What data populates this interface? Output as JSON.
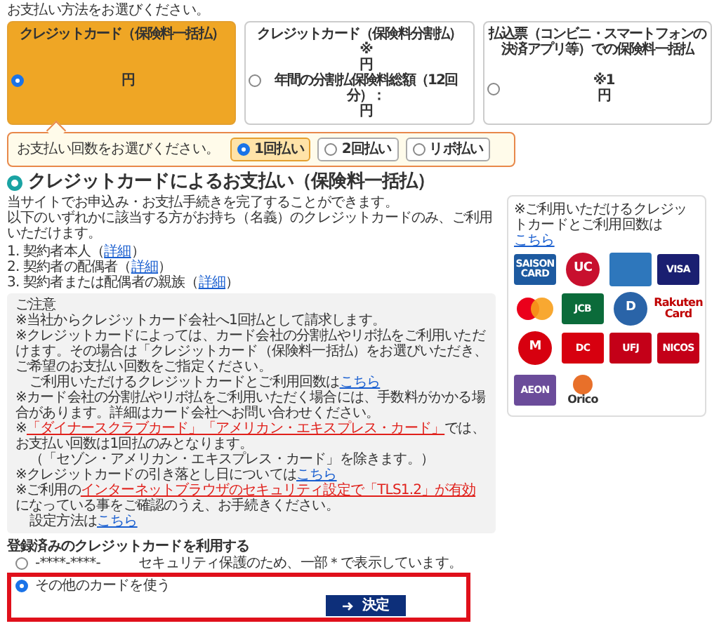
{
  "prompt": "お支払い方法をお選びください。",
  "methods": [
    {
      "title": "クレジットカード（保険料一括払）",
      "selected": true,
      "lines": [
        "円"
      ]
    },
    {
      "title": "クレジットカード（保険料分割払）",
      "selected": false,
      "lines": [
        "※",
        "円",
        "年間の分割払保険料総額（12回分）：",
        "円"
      ]
    },
    {
      "title": "払込票（コンビニ・スマートフォンの決済アプリ等）での保険料一括払",
      "selected": false,
      "lines": [
        "※1",
        "円"
      ]
    }
  ],
  "installments": {
    "label": "お支払い回数をお選びください。",
    "options": [
      {
        "label": "1回払い",
        "selected": true
      },
      {
        "label": "2回払い",
        "selected": false
      },
      {
        "label": "リボ払い",
        "selected": false
      }
    ]
  },
  "heading": "クレジットカードによるお支払い（保険料一括払）",
  "intro": [
    "当サイトでお申込み・お支払手続きを完了することができます。",
    "以下のいずれかに該当する方がお持ち（名義）のクレジットカードのみ、ご利用いただけます。"
  ],
  "holders": [
    {
      "number": "1.",
      "text": "契約者本人（",
      "link": "詳細",
      "after": "）"
    },
    {
      "number": "2.",
      "text": "契約者の配偶者（",
      "link": "詳細",
      "after": "）"
    },
    {
      "number": "3.",
      "text": "契約者または配偶者の親族（",
      "link": "詳細",
      "after": "）"
    }
  ],
  "notes": {
    "title": "ご注意",
    "items": [
      [
        [
          {
            "kind": "text",
            "text": "※当社からクレジットカード会社へ1回払として請求します。"
          }
        ]
      ],
      [
        [
          {
            "kind": "text",
            "text": "※クレジットカードによっては、カード会社の分割払やリボ払をご利用いただけます。その場合は「クレジットカード（保険料一括払）をお選びいただき、ご希望のお支払い回数をご指定ください。"
          }
        ],
        [
          {
            "kind": "text",
            "text": "ご利用いただけるクレジットカードとご利用回数は"
          },
          {
            "kind": "link",
            "text": "こちら"
          }
        ]
      ],
      [
        [
          {
            "kind": "text",
            "text": "※カード会社の分割払やリボ払をご利用いただく場合には、手数料がかかる場合があります。詳細はカード会社へお問い合わせください。"
          }
        ]
      ],
      [
        [
          {
            "kind": "text",
            "text": "※"
          },
          {
            "kind": "red_link",
            "text": "「ダイナースクラブカード」「アメリカン・エキスプレス・カード」"
          },
          {
            "kind": "text",
            "text": "では、お支払い回数は1回払のみとなります。"
          }
        ],
        [
          {
            "kind": "text",
            "text": "（「セゾン・アメリカン・エキスプレス・カード」を除きます。）"
          }
        ]
      ],
      [
        [
          {
            "kind": "text",
            "text": "※クレジットカードの引き落とし日については"
          },
          {
            "kind": "link",
            "text": "こちら"
          }
        ]
      ],
      [
        [
          {
            "kind": "text",
            "text": "※ご利用の"
          },
          {
            "kind": "red_link",
            "text": "インターネットブラウザのセキュリティ設定で「TLS1.2」が有効"
          },
          {
            "kind": "text",
            "text": "になっている事をご確認のうえ、お手続きください。"
          }
        ],
        [
          {
            "kind": "text",
            "text": "設定方法は"
          },
          {
            "kind": "link",
            "text": "こちら"
          }
        ]
      ]
    ]
  },
  "card_panel": {
    "text": "※ご利用いただけるクレジットカードとご利用回数は",
    "link": "こちら",
    "logos": [
      {
        "kind": "tile",
        "label": "SAISON CARD",
        "color": "#1d5aa0"
      },
      {
        "kind": "round",
        "label": "UC",
        "color": "#c8102e"
      },
      {
        "kind": "blank",
        "color": "#2e77bc"
      },
      {
        "kind": "tile",
        "label": "VISA",
        "color": "#1a1f71"
      },
      {
        "kind": "circles"
      },
      {
        "kind": "tile",
        "label": "JCB",
        "color": "#0b6b3a"
      },
      {
        "kind": "round",
        "label": "D",
        "color": "#2a64a8"
      },
      {
        "kind": "text",
        "label": "Rakuten Card",
        "color": "#bf0000"
      },
      {
        "kind": "round",
        "label": "M",
        "color": "#d7000f"
      },
      {
        "kind": "tile",
        "label": "DC",
        "color": "#d7000f"
      },
      {
        "kind": "tile",
        "label": "UFJ",
        "color": "#c40018"
      },
      {
        "kind": "tile",
        "label": "NICOS",
        "color": "#c40018"
      },
      {
        "kind": "tile",
        "label": "AEON",
        "color": "#6b4c9a"
      },
      {
        "kind": "dot",
        "label": "Orico",
        "color": "#e8702a"
      }
    ]
  },
  "registered": {
    "title": "登録済みのクレジットカードを利用する",
    "options": [
      {
        "selected": false,
        "label": "-****-****-",
        "note": "セキュリティ保護のため、一部＊で表示しています。",
        "highlighted": false
      },
      {
        "selected": true,
        "label": "その他のカードを使う",
        "highlighted": true
      }
    ],
    "button": "決定"
  }
}
